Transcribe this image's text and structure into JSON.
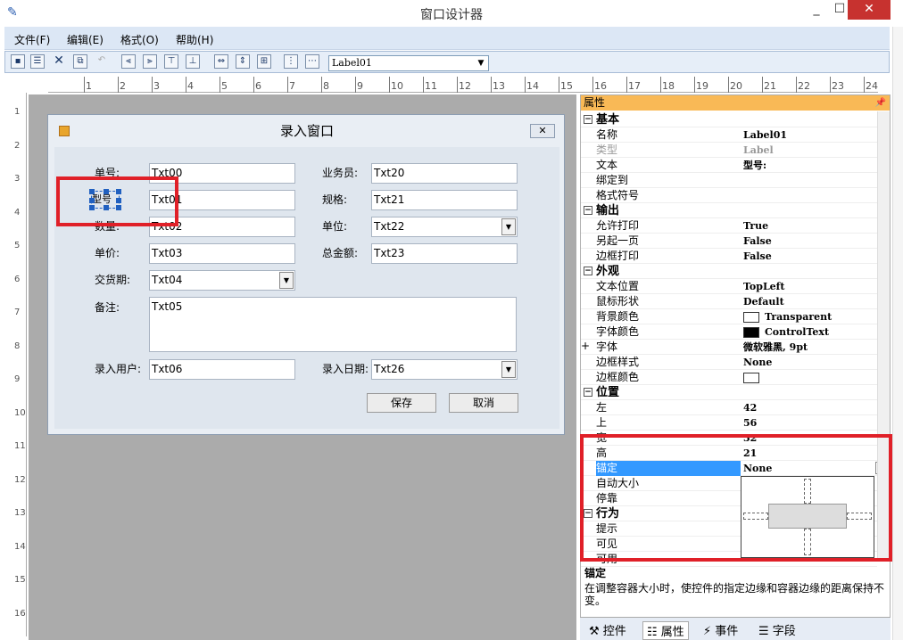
{
  "window": {
    "title": "窗口设计器",
    "min": "_",
    "max": "☐",
    "close": "✕"
  },
  "menu": [
    "文件(F)",
    "编辑(E)",
    "格式(O)",
    "帮助(H)"
  ],
  "toolbar": {
    "combo_value": "Label01"
  },
  "ruler": {
    "h": [
      "1",
      "2",
      "3",
      "4",
      "5",
      "6",
      "7",
      "8",
      "9",
      "10",
      "11",
      "12",
      "13",
      "14",
      "15",
      "16",
      "17",
      "18",
      "19",
      "20",
      "21",
      "22",
      "23",
      "24"
    ],
    "v": [
      "1",
      "2",
      "3",
      "4",
      "5",
      "6",
      "7",
      "8",
      "9",
      "10",
      "11",
      "12",
      "13",
      "14",
      "15",
      "16"
    ]
  },
  "form": {
    "title": "录入窗口",
    "labels": {
      "l00": "单号:",
      "l01": "型号",
      "l02": "数量:",
      "l03": "单价:",
      "l04": "交货期:",
      "l05": "备注:",
      "l06": "录入用户:",
      "l20": "业务员:",
      "l21": "规格:",
      "l22": "单位:",
      "l23": "总金额:",
      "l26": "录入日期:"
    },
    "fields": {
      "t00": "Txt00",
      "t01": "Txt01",
      "t02": "Txt02",
      "t03": "Txt03",
      "t04": "Txt04",
      "t05": "Txt05",
      "t06": "Txt06",
      "t20": "Txt20",
      "t21": "Txt21",
      "t22": "Txt22",
      "t23": "Txt23",
      "t26": "Txt26"
    },
    "save": "保存",
    "cancel": "取消"
  },
  "props": {
    "header": "属性",
    "rows": [
      {
        "cat": true,
        "name": "基本"
      },
      {
        "name": "名称",
        "value": "Label01"
      },
      {
        "name": "类型",
        "value": "Label",
        "dim": true
      },
      {
        "name": "文本",
        "value": "型号:"
      },
      {
        "name": "绑定到",
        "value": ""
      },
      {
        "name": "格式符号",
        "value": ""
      },
      {
        "cat": true,
        "name": "输出"
      },
      {
        "name": "允许打印",
        "value": "True"
      },
      {
        "name": "另起一页",
        "value": "False"
      },
      {
        "name": "边框打印",
        "value": "False"
      },
      {
        "cat": true,
        "name": "外观"
      },
      {
        "name": "文本位置",
        "value": "TopLeft"
      },
      {
        "name": "鼠标形状",
        "value": "Default"
      },
      {
        "name": "背景颜色",
        "value": "Transparent",
        "swatch": "#ffffff"
      },
      {
        "name": "字体颜色",
        "value": "ControlText",
        "swatch": "#000000"
      },
      {
        "name": "字体",
        "value": "微软雅黑, 9pt",
        "plus": true
      },
      {
        "name": "边框样式",
        "value": "None"
      },
      {
        "name": "边框颜色",
        "value": "",
        "swatch": "#ffffff"
      },
      {
        "cat": true,
        "name": "位置"
      },
      {
        "name": "左",
        "value": "42"
      },
      {
        "name": "上",
        "value": "56"
      },
      {
        "name": "宽",
        "value": "32"
      },
      {
        "name": "高",
        "value": "21"
      },
      {
        "name": "锚定",
        "value": "None",
        "selected": true
      },
      {
        "name": "自动大小",
        "value": ""
      },
      {
        "name": "停靠",
        "value": ""
      },
      {
        "cat": true,
        "name": "行为"
      },
      {
        "name": "提示",
        "value": ""
      },
      {
        "name": "可见",
        "value": ""
      },
      {
        "name": "可用",
        "value": ""
      }
    ],
    "help_title": "锚定",
    "help_text": "在调整容器大小时，使控件的指定边缘和容器边缘的距离保持不变。"
  },
  "tabs": [
    "控件",
    "属性",
    "事件",
    "字段"
  ]
}
